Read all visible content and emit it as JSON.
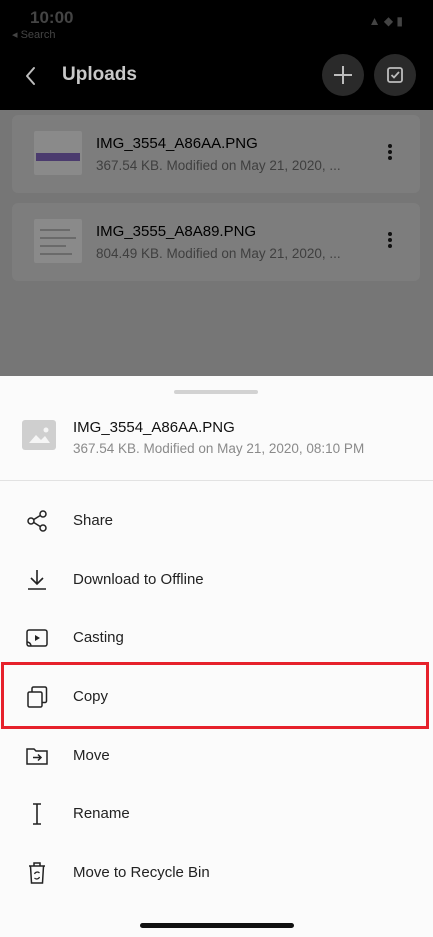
{
  "status_bar": {
    "time": "10:00",
    "carrier": "◂ Search",
    "icons": "▲ ◆ ▮"
  },
  "header": {
    "title": "Uploads"
  },
  "files": [
    {
      "name": "IMG_3554_A86AA.PNG",
      "meta": "367.54 KB. Modified on May 21, 2020, ..."
    },
    {
      "name": "IMG_3555_A8A89.PNG",
      "meta": "804.49 KB. Modified on May 21, 2020, ..."
    }
  ],
  "sheet": {
    "file_name": "IMG_3554_A86AA.PNG",
    "file_meta": "367.54 KB. Modified on May 21, 2020, 08:10 PM",
    "actions": [
      {
        "label": "Share",
        "icon": "share-icon"
      },
      {
        "label": "Download to Offline",
        "icon": "download-icon"
      },
      {
        "label": "Casting",
        "icon": "cast-icon"
      },
      {
        "label": "Copy",
        "icon": "copy-icon"
      },
      {
        "label": "Move",
        "icon": "move-icon"
      },
      {
        "label": "Rename",
        "icon": "rename-icon"
      },
      {
        "label": "Move to Recycle Bin",
        "icon": "recycle-bin-icon"
      }
    ]
  },
  "colors": {
    "highlight": "#e6212b",
    "header_bg": "#000000",
    "overlay": "#777777"
  }
}
